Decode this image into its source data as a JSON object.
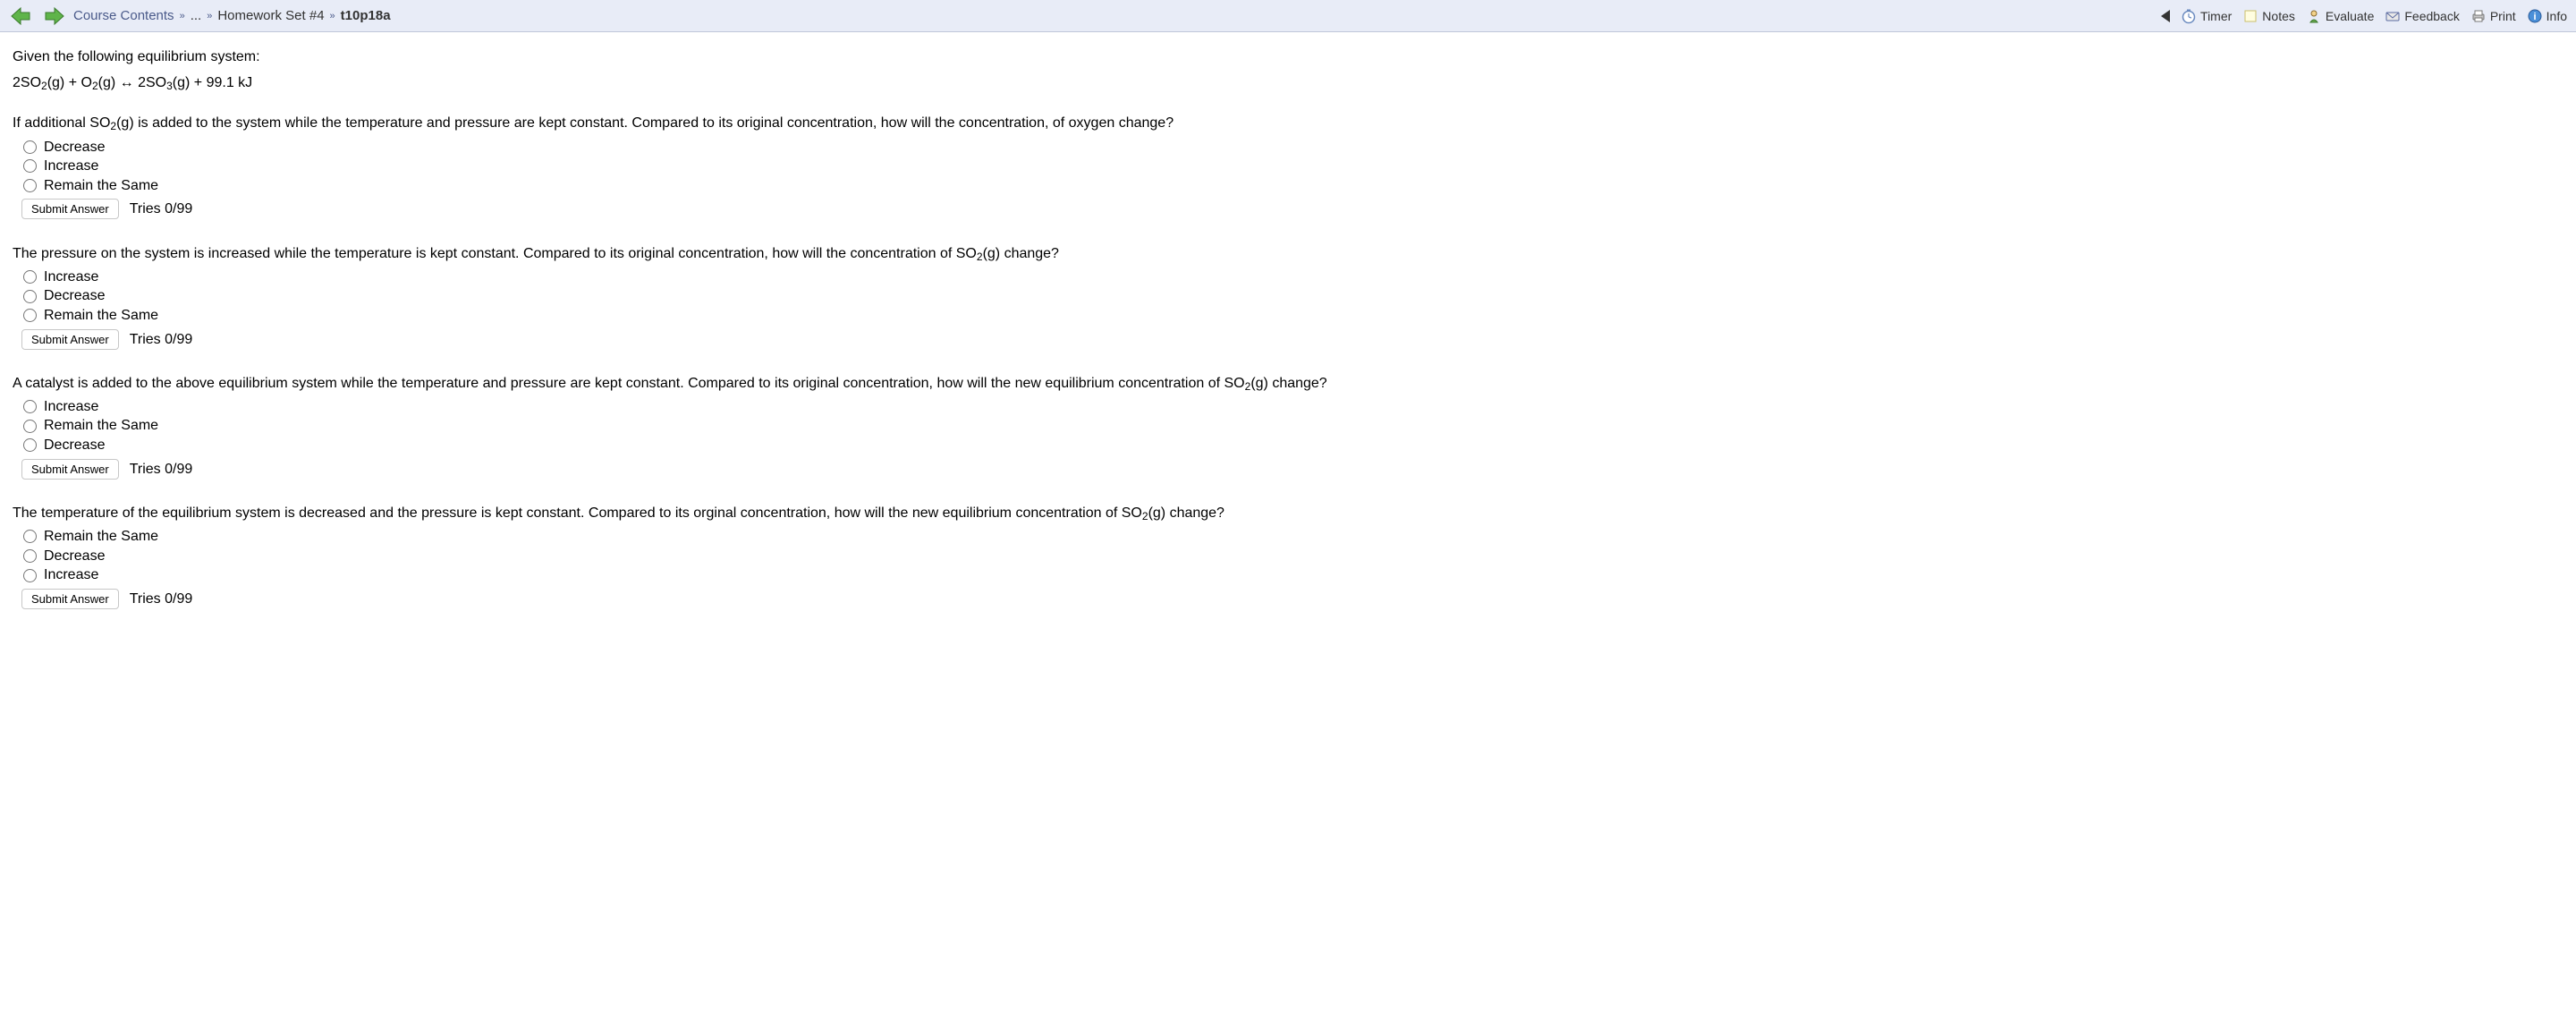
{
  "topbar": {
    "breadcrumb": {
      "course_contents": "Course Contents",
      "ellipsis": "...",
      "homework": "Homework Set #4",
      "current": "t10p18a",
      "sep": "»"
    },
    "tools": {
      "timer": "Timer",
      "notes": "Notes",
      "evaluate": "Evaluate",
      "feedback": "Feedback",
      "print": "Print",
      "info": "Info"
    }
  },
  "intro": "Given the following equilibrium system:",
  "equation_parts": {
    "p1": "2SO",
    "s1": "2",
    "p2": "(g) + O",
    "s2": "2",
    "p3": "(g) ↔ 2SO",
    "s3": "3",
    "p4": "(g) + 99.1 kJ"
  },
  "questions": [
    {
      "text_parts": [
        "If additional SO",
        "2",
        "(g) is added to the system while the temperature and pressure are kept constant. Compared to its original concentration, how will the concentration, of oxygen change?"
      ],
      "options": [
        "Decrease",
        "Increase",
        "Remain the Same"
      ],
      "submit": "Submit Answer",
      "tries": "Tries 0/99"
    },
    {
      "text_parts": [
        "The pressure on the system is increased while the temperature is kept constant. Compared to its original concentration, how will the concentration of SO",
        "2",
        "(g) change?"
      ],
      "options": [
        "Increase",
        "Decrease",
        "Remain the Same"
      ],
      "submit": "Submit Answer",
      "tries": "Tries 0/99"
    },
    {
      "text_parts": [
        "A catalyst is added to the above equilibrium system while the temperature and pressure are kept constant. Compared to its original concentration, how will the new equilibrium concentration of SO",
        "2",
        "(g) change?"
      ],
      "options": [
        "Increase",
        "Remain the Same",
        "Decrease"
      ],
      "submit": "Submit Answer",
      "tries": "Tries 0/99"
    },
    {
      "text_parts": [
        "The temperature of the equilibrium system is decreased and the pressure is kept constant. Compared to its orginal concentration, how will the new equilibrium concentration of SO",
        "2",
        "(g) change?"
      ],
      "options": [
        "Remain the Same",
        "Decrease",
        "Increase"
      ],
      "submit": "Submit Answer",
      "tries": "Tries 0/99"
    }
  ]
}
